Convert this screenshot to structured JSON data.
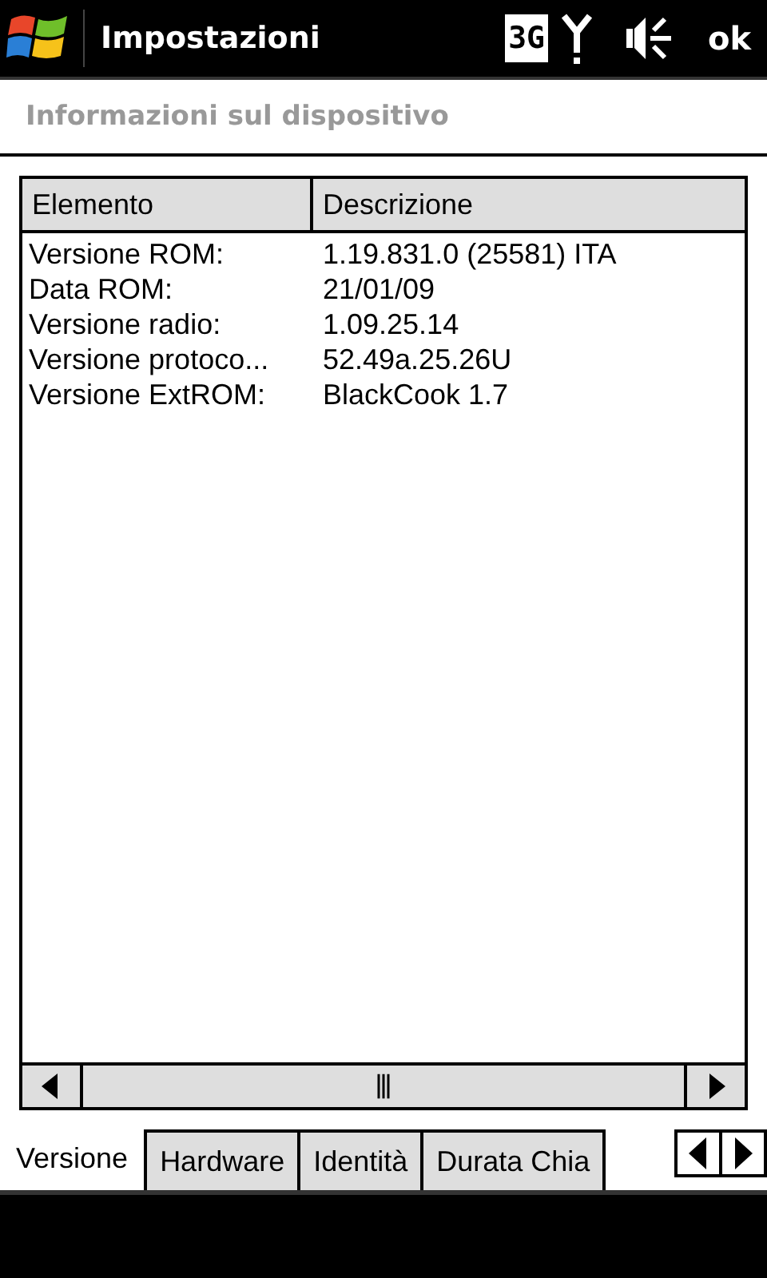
{
  "title_bar": {
    "title": "Impostazioni",
    "network_type": "3G",
    "ok_button": "ok"
  },
  "heading": "Informazioni sul dispositivo",
  "table": {
    "columns": [
      "Elemento",
      "Descrizione"
    ],
    "rows": [
      [
        "Versione ROM:",
        "1.19.831.0 (25581) ITA"
      ],
      [
        "Data ROM:",
        "21/01/09"
      ],
      [
        "Versione radio:",
        "1.09.25.14"
      ],
      [
        "Versione protoco...",
        "52.49a.25.26U"
      ],
      [
        "Versione ExtROM:",
        "BlackCook 1.7"
      ]
    ]
  },
  "tabs": [
    {
      "label": "Versione",
      "selected": true
    },
    {
      "label": "Hardware",
      "selected": false
    },
    {
      "label": "Identità",
      "selected": false
    },
    {
      "label": "Durata Chia",
      "selected": false
    }
  ]
}
